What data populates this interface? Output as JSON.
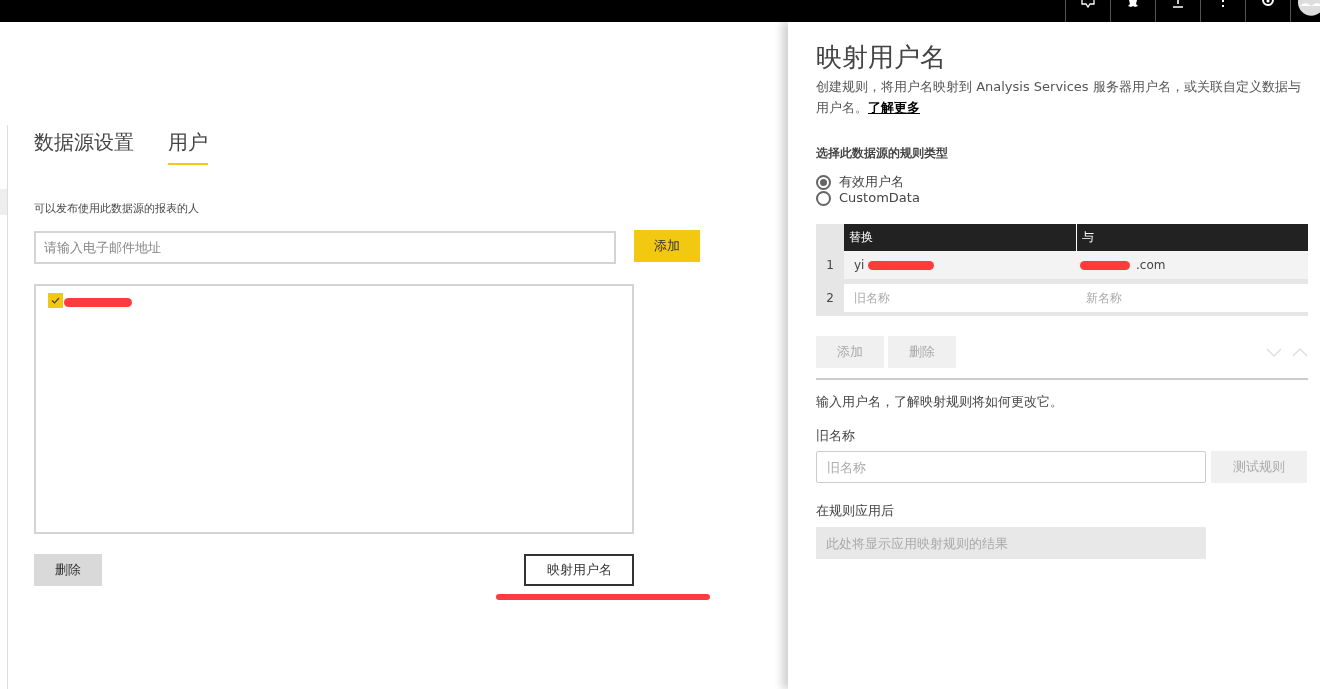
{
  "tabs": [
    {
      "label": "数据源设置",
      "selected": false
    },
    {
      "label": "用户",
      "selected": true
    }
  ],
  "users_section": {
    "label": "可以发布使用此数据源的报表的人",
    "email_field": {
      "placeholder": "请输入电子邮件地址"
    },
    "add_button": "添加",
    "users": [
      {
        "checked": true,
        "redacted": true
      }
    ],
    "delete_button": "删除",
    "map_button": "映射用户名",
    "map_button_underlined": true
  },
  "panel": {
    "title": "映射用户名",
    "description": "创建规则，将用户名映射到 Analysis Services 服务器用户名，或关联自定义数据与用户名。",
    "learn_more": "了解更多",
    "rule_type_label": "选择此数据源的规则类型",
    "rule_types": [
      {
        "label": "有效用户名",
        "selected": true
      },
      {
        "label": "CustomData",
        "selected": false
      }
    ],
    "table": {
      "columns": [
        "替换",
        "与"
      ],
      "rows": [
        {
          "number": "1",
          "replace": "yi",
          "with": ".com",
          "redacted": true
        },
        {
          "number": "2",
          "replace_placeholder": "旧名称",
          "with_placeholder": "新名称"
        }
      ]
    },
    "add_button": {
      "label": "添加",
      "disabled": true
    },
    "delete_button": {
      "label": "删除",
      "disabled": true
    },
    "test_hint": "输入用户名，了解映射规则将如何更改它。",
    "old_name_label": "旧名称",
    "old_name_field": {
      "placeholder": "旧名称"
    },
    "test_button": {
      "label": "测试规则",
      "disabled": true
    },
    "result_label": "在规则应用后",
    "result_field": {
      "placeholder": "此处将显示应用映射规则的结果"
    }
  }
}
